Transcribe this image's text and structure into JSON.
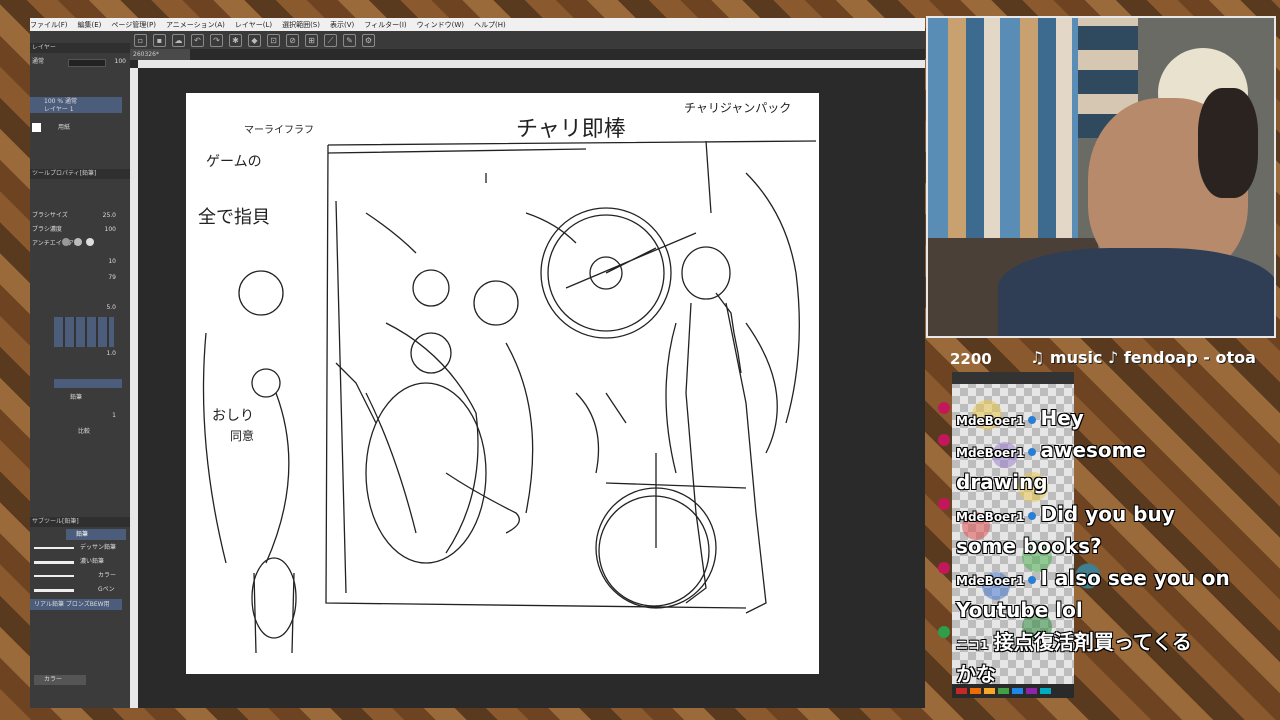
{
  "app": {
    "menu": [
      "ファイル(F)",
      "編集(E)",
      "ページ管理(P)",
      "アニメーション(A)",
      "レイヤー(L)",
      "選択範囲(S)",
      "表示(V)",
      "フィルター(I)",
      "ウィンドウ(W)",
      "ヘルプ(H)"
    ],
    "canvas_tab": "260326*",
    "layers": {
      "blend_mode": "通常",
      "opacity": "100",
      "layer1_line1": "100 % 通常",
      "layer1_line2": "レイヤー 1",
      "paper_label": "用紙"
    },
    "tool_property": {
      "header": "ツールプロパティ[鉛筆]",
      "size_label": "ブラシサイズ",
      "size_value": "25.0",
      "density_label": "ブラシ濃度",
      "density_value": "100",
      "antialias_label": "アンチエイリアス",
      "val1": "10",
      "val2": "79",
      "val3": "5.0",
      "val4": "1.0",
      "pencil_label": "鉛筆",
      "val5": "1",
      "combine_label": "比較"
    },
    "subtool": {
      "tab_active": "鉛筆",
      "brushes": [
        "デッサン鉛筆",
        "濃い鉛筆",
        "カラー",
        "Gペン",
        "リアル鉛筆 ブロンズBEW用"
      ]
    },
    "color_panel": {
      "mode": "カラー"
    }
  },
  "drawing_texts": [
    "チャリ即棒",
    "チャリジャンパック",
    "マーライフラフ",
    "ゲームの",
    "全で指貝",
    "おしり",
    "同意"
  ],
  "stream": {
    "view_count": "2200",
    "music": "♫ music ♪ fendoap - otoa",
    "chat": [
      {
        "name": "MdeBoer1",
        "text_lines": [
          "Hey"
        ],
        "badge": "pink"
      },
      {
        "name": "MdeBoer1",
        "text_lines": [
          "awesome",
          "drawing"
        ],
        "badge": "pink"
      },
      {
        "name": "MdeBoer1",
        "text_lines": [
          "Did you buy",
          "some books?"
        ],
        "badge": "pink"
      },
      {
        "name": "MdeBoer1",
        "text_lines": [
          "I also see you on",
          "Youtube lol"
        ],
        "badge": "pink"
      },
      {
        "name": "ニコ1",
        "text_lines": [
          "接点復活剤買ってくる",
          "かな"
        ],
        "badge": "green"
      }
    ]
  },
  "colors": {
    "accent": "#4b5d7b",
    "badge_pink": "#c2185b",
    "badge_green": "#2e9e4a"
  }
}
